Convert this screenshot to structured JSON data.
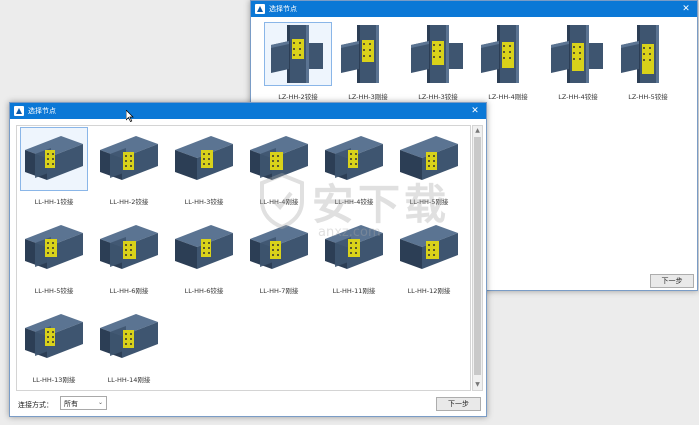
{
  "back_dialog": {
    "title": "选择节点",
    "close": "✕",
    "items": [
      {
        "label": "LZ-HH-2铰接",
        "icon": "column-beam-hinge-connection"
      },
      {
        "label": "LZ-HH-3刚接",
        "icon": "column-beam-rigid-connection"
      },
      {
        "label": "LZ-HH-3铰接",
        "icon": "column-beam-hinge-connection"
      },
      {
        "label": "LZ-HH-4刚接",
        "icon": "column-beam-rigid-connection"
      },
      {
        "label": "LZ-HH-4铰接",
        "icon": "column-beam-hinge-connection"
      },
      {
        "label": "LZ-HH-5铰接",
        "icon": "column-beam-hinge-connection"
      }
    ],
    "next_button": "下一步"
  },
  "front_dialog": {
    "title": "选择节点",
    "close": "✕",
    "items": [
      {
        "label": "LL-HH-1铰接",
        "icon": "beam-beam-hinge-connection"
      },
      {
        "label": "LL-HH-2铰接",
        "icon": "beam-beam-hinge-connection"
      },
      {
        "label": "LL-HH-3铰接",
        "icon": "beam-beam-hinge-connection"
      },
      {
        "label": "LL-HH-4刚接",
        "icon": "beam-beam-rigid-connection"
      },
      {
        "label": "LL-HH-4铰接",
        "icon": "beam-beam-hinge-connection"
      },
      {
        "label": "LL-HH-5刚接",
        "icon": "beam-beam-rigid-connection"
      },
      {
        "label": "LL-HH-5铰接",
        "icon": "beam-beam-hinge-connection"
      },
      {
        "label": "LL-HH-6刚接",
        "icon": "beam-beam-rigid-connection"
      },
      {
        "label": "LL-HH-6铰接",
        "icon": "beam-beam-hinge-connection"
      },
      {
        "label": "LL-HH-7刚接",
        "icon": "beam-beam-rigid-connection"
      },
      {
        "label": "LL-HH-11刚接",
        "icon": "beam-beam-rigid-connection"
      },
      {
        "label": "LL-HH-12刚接",
        "icon": "beam-beam-rigid-connection"
      },
      {
        "label": "LL-HH-13刚接",
        "icon": "beam-beam-rigid-connection"
      },
      {
        "label": "LL-HH-14刚接",
        "icon": "beam-beam-rigid-connection"
      }
    ],
    "connection_label": "连接方式：",
    "connection_value": "所有",
    "next_button": "下一步"
  },
  "watermark": {
    "main": "安下载",
    "sub": "anxz.com"
  },
  "colors": {
    "titlebar": "#0b78d6",
    "steel": "#3e5570",
    "plate": "#d9d21a"
  }
}
